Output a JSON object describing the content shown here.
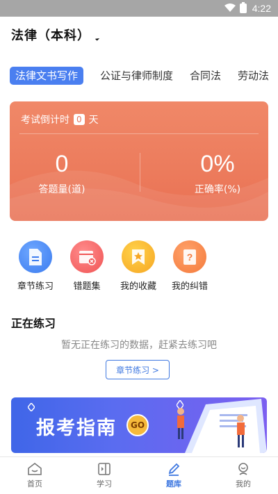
{
  "status_bar": {
    "time": "4:22",
    "wifi_icon": "wifi-icon",
    "battery_icon": "battery-icon"
  },
  "header": {
    "title": "法律（本科）",
    "dropdown_icon": "caret-icon"
  },
  "tabs": [
    {
      "label": "法律文书写作",
      "active": true
    },
    {
      "label": "公证与律师制度",
      "active": false
    },
    {
      "label": "合同法",
      "active": false
    },
    {
      "label": "劳动法",
      "active": false
    }
  ],
  "stats_card": {
    "countdown_prefix": "考试倒计时",
    "countdown_days": "0",
    "countdown_suffix": "天",
    "answered_value": "0",
    "answered_label": "答题量(道)",
    "accuracy_value": "0%",
    "accuracy_label": "正确率(%)"
  },
  "quick_actions": [
    {
      "label": "章节练习",
      "icon": "document-icon",
      "color": "#3b7bef"
    },
    {
      "label": "错题集",
      "icon": "wrong-book-icon",
      "color": "#f05454"
    },
    {
      "label": "我的收藏",
      "icon": "bookmark-star-icon",
      "color": "#f6a623"
    },
    {
      "label": "我的纠错",
      "icon": "question-book-icon",
      "color": "#f47a3c"
    }
  ],
  "practice": {
    "title": "正在练习",
    "empty_text": "暂无正在练习的数据，赶紧去练习吧",
    "button_label": "章节练习 >"
  },
  "banner": {
    "title": "报考指南",
    "go_label": "GO"
  },
  "bottom_nav": [
    {
      "label": "首页",
      "icon": "home-icon",
      "active": false
    },
    {
      "label": "学习",
      "icon": "study-icon",
      "active": false
    },
    {
      "label": "题库",
      "icon": "pen-icon",
      "active": true
    },
    {
      "label": "我的",
      "icon": "profile-icon",
      "active": false
    }
  ],
  "colors": {
    "accent": "#3f78e0",
    "card": "#ec7b5c"
  }
}
